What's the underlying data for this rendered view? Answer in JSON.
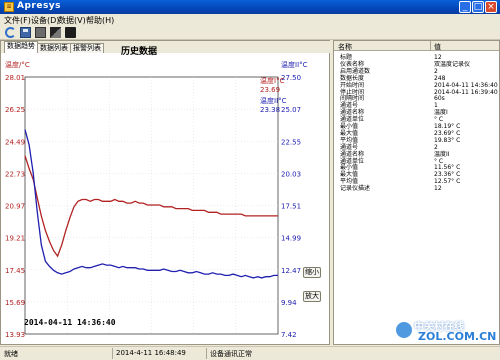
{
  "window": {
    "title": "Apresys",
    "icon": "app-thermometer-icon"
  },
  "menu": [
    "文件(F)",
    "设备(D)",
    "数据(V)",
    "帮助(H)"
  ],
  "toolbar": {
    "icons": [
      "refresh-icon",
      "save-icon",
      "print-icon",
      "export-icon",
      "folder-icon"
    ]
  },
  "tabs": [
    "数据趋势",
    "数据列表",
    "报警列表"
  ],
  "active_tab": 0,
  "chart_title": "历史数据",
  "left_axis_label": "温度/°C",
  "right_axis_label": "温度II°C",
  "series_labels": [
    {
      "name": "温度I°C",
      "value": "23.69",
      "color": "#b22222"
    },
    {
      "name": "温度II°C",
      "value": "23.38",
      "color": "#2020b0"
    }
  ],
  "zoom_in_label": "缩小",
  "zoom_out_label": "放大",
  "cursor_time": "2014-04-11 14:36:40",
  "list_header": {
    "name": "名称",
    "value": "值"
  },
  "list_rows": [
    {
      "k": "标题",
      "v": "12"
    },
    {
      "k": "仪表名称",
      "v": "双温度记录仪"
    },
    {
      "k": "启用通道数",
      "v": "2"
    },
    {
      "k": "数据长度",
      "v": "248"
    },
    {
      "k": "开始时间",
      "v": "2014-04-11 14:36:40"
    },
    {
      "k": "停止时间",
      "v": "2014-04-11 16:39:40"
    },
    {
      "k": "间隔时间",
      "v": "60s"
    },
    {
      "k": "通道号",
      "v": "1"
    },
    {
      "k": "通道名称",
      "v": "温度I"
    },
    {
      "k": "通道单位",
      "v": "° C"
    },
    {
      "k": "最小值",
      "v": "18.19° C"
    },
    {
      "k": "最大值",
      "v": "23.69° C"
    },
    {
      "k": "平均值",
      "v": "19.83° C"
    },
    {
      "k": "通道号",
      "v": "2"
    },
    {
      "k": "通道名称",
      "v": "温度II"
    },
    {
      "k": "通道单位",
      "v": "° C"
    },
    {
      "k": "最小值",
      "v": "11.56° C"
    },
    {
      "k": "最大值",
      "v": "23.36° C"
    },
    {
      "k": "平均值",
      "v": "12.57° C"
    },
    {
      "k": "记录仪描述",
      "v": "12"
    }
  ],
  "status": {
    "left": "就绪",
    "time": "2014-4-11 16:48:49",
    "state": "设备通讯正常"
  },
  "watermark": {
    "cn": "中关村在线",
    "en": "ZOL.COM.CN"
  },
  "colors": {
    "series1": "#b22222",
    "series2": "#2020b0",
    "left_axis": "#b22222",
    "right_axis": "#2020b0"
  },
  "chart_data": {
    "type": "line",
    "left_axis": {
      "label": "温度/°C",
      "ylim": [
        13.93,
        28.01
      ],
      "ticks": [
        "28.01",
        "26.25",
        "24.49",
        "22.73",
        "20.97",
        "19.21",
        "17.45",
        "15.69",
        "13.93"
      ]
    },
    "right_axis": {
      "label": "温度II°C",
      "ylim": [
        7.42,
        27.5
      ],
      "ticks": [
        "27.50",
        "25.07",
        "22.55",
        "20.03",
        "17.51",
        "14.99",
        "12.47",
        "9.94",
        "7.42"
      ]
    },
    "x": [
      0,
      4,
      8,
      12,
      16,
      20,
      24,
      28,
      32,
      36,
      40,
      44,
      48,
      52,
      56,
      60,
      64,
      68,
      72,
      76,
      80,
      84,
      88,
      92,
      96,
      100,
      104,
      108,
      112,
      116,
      120,
      124,
      128,
      132,
      136,
      140,
      144,
      148,
      152,
      156,
      160,
      164,
      168,
      172,
      176,
      180,
      184,
      188,
      192,
      196,
      200,
      204,
      208,
      212,
      216,
      220,
      224,
      228,
      232,
      236,
      240,
      244,
      248
    ],
    "series": [
      {
        "name": "温度I°C",
        "axis": "left",
        "values": [
          23.7,
          23.0,
          22.4,
          21.4,
          20.4,
          19.6,
          19.0,
          18.5,
          18.2,
          18.8,
          19.6,
          20.3,
          20.9,
          21.2,
          21.3,
          21.3,
          21.2,
          21.3,
          21.3,
          21.2,
          21.2,
          21.2,
          21.3,
          21.2,
          21.2,
          21.1,
          21.1,
          21.2,
          21.1,
          21.1,
          21.0,
          21.0,
          21.0,
          21.0,
          20.9,
          20.9,
          20.9,
          20.8,
          20.8,
          20.8,
          20.8,
          20.7,
          20.7,
          20.7,
          20.7,
          20.6,
          20.6,
          20.6,
          20.5,
          20.5,
          20.5,
          20.5,
          20.5,
          20.5,
          20.4,
          20.4,
          20.4,
          20.4,
          20.4,
          20.4,
          20.4,
          20.4,
          20.4
        ]
      },
      {
        "name": "温度II°C",
        "axis": "right",
        "values": [
          23.4,
          22.2,
          20.0,
          17.0,
          14.4,
          13.1,
          12.7,
          12.4,
          12.2,
          12.1,
          12.2,
          12.3,
          12.5,
          12.6,
          12.7,
          12.6,
          12.6,
          12.7,
          12.8,
          12.9,
          12.8,
          12.8,
          12.7,
          12.6,
          12.7,
          12.6,
          12.6,
          12.6,
          12.5,
          12.5,
          12.4,
          12.4,
          12.4,
          12.4,
          12.5,
          12.4,
          12.3,
          12.3,
          12.4,
          12.3,
          12.2,
          12.2,
          12.3,
          12.2,
          12.1,
          12.1,
          12.2,
          12.1,
          12.1,
          12.0,
          12.0,
          12.1,
          12.0,
          11.9,
          12.0,
          11.9,
          11.8,
          11.9,
          11.8,
          11.9,
          11.9,
          12.0,
          12.0
        ]
      }
    ],
    "grid": true,
    "legend": "top-right"
  }
}
